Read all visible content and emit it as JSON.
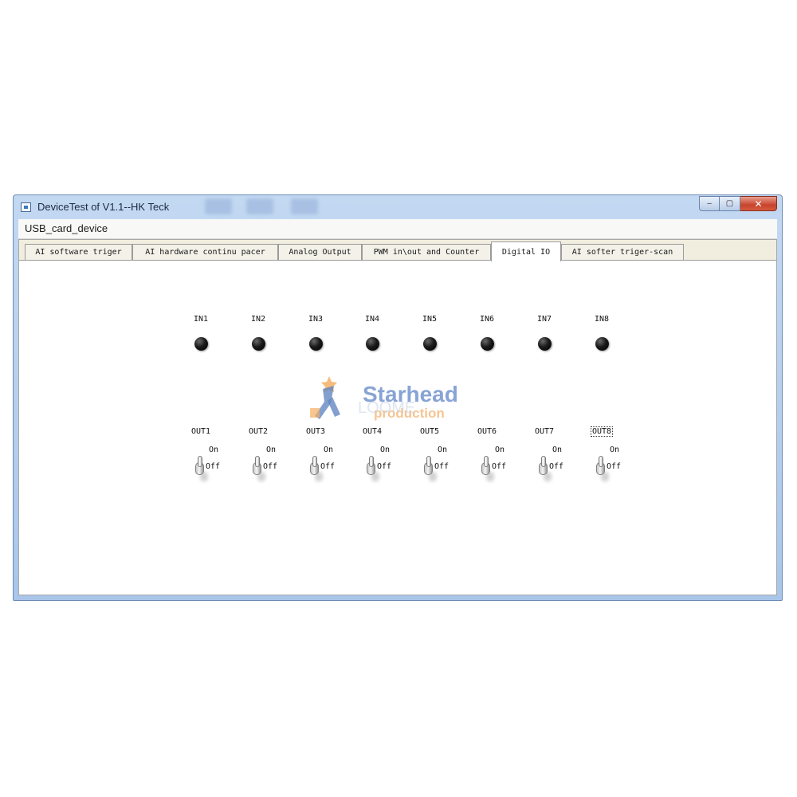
{
  "window": {
    "title": "DeviceTest of V1.1--HK Teck",
    "buttons": {
      "minimize": "‒",
      "maximize": "▢",
      "close": "✕"
    }
  },
  "menu": {
    "items": [
      "USB_card_device"
    ]
  },
  "tabs": [
    {
      "label": "AI software triger",
      "active": false
    },
    {
      "label": "AI hardware continu pacer",
      "active": false
    },
    {
      "label": "Analog Output",
      "active": false
    },
    {
      "label": "PWM in\\out and Counter",
      "active": false
    },
    {
      "label": "Digital IO",
      "active": true
    },
    {
      "label": "AI softer triger-scan",
      "active": false
    }
  ],
  "digital_io": {
    "inputs": [
      {
        "label": "IN1",
        "state": "off"
      },
      {
        "label": "IN2",
        "state": "off"
      },
      {
        "label": "IN3",
        "state": "off"
      },
      {
        "label": "IN4",
        "state": "off"
      },
      {
        "label": "IN5",
        "state": "off"
      },
      {
        "label": "IN6",
        "state": "off"
      },
      {
        "label": "IN7",
        "state": "off"
      },
      {
        "label": "IN8",
        "state": "off"
      }
    ],
    "outputs": [
      {
        "label": "OUT1",
        "on_label": "On",
        "off_label": "Off",
        "state": "off"
      },
      {
        "label": "OUT2",
        "on_label": "On",
        "off_label": "Off",
        "state": "off"
      },
      {
        "label": "OUT3",
        "on_label": "On",
        "off_label": "Off",
        "state": "off"
      },
      {
        "label": "OUT4",
        "on_label": "On",
        "off_label": "Off",
        "state": "off"
      },
      {
        "label": "OUT5",
        "on_label": "On",
        "off_label": "Off",
        "state": "off"
      },
      {
        "label": "OUT6",
        "on_label": "On",
        "off_label": "Off",
        "state": "off"
      },
      {
        "label": "OUT7",
        "on_label": "On",
        "off_label": "Off",
        "state": "off"
      },
      {
        "label": "OUT8",
        "on_label": "On",
        "off_label": "Off",
        "state": "off",
        "focused": true
      }
    ]
  },
  "watermark": {
    "brand": "Starhead",
    "sub": "production",
    "ghost": "LOOME"
  },
  "colors": {
    "titlebar": "#b3cdec",
    "tabstrip": "#f1eee0",
    "led_off": "#111111",
    "close_button": "#c8442c",
    "watermark_blue": "#4a72b8",
    "watermark_orange": "#f2a24a"
  }
}
